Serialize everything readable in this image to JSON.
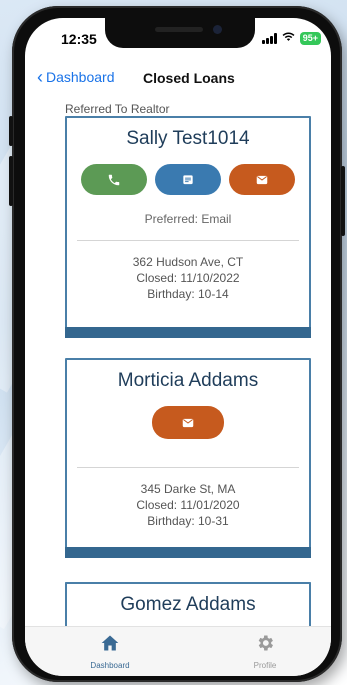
{
  "status_bar": {
    "time": "12:35",
    "battery": "95+"
  },
  "nav": {
    "back_label": "Dashboard",
    "title": "Closed Loans"
  },
  "section_label": "Referred To Realtor",
  "cards": [
    {
      "name": "Sally Test1014",
      "preferred": "Preferred: Email",
      "address": "362 Hudson Ave, CT",
      "closed": "Closed: 11/10/2022",
      "birthday": "Birthday: 10-14"
    },
    {
      "name": "Morticia Addams",
      "address": "345 Darke St, MA",
      "closed": "Closed: 11/01/2020",
      "birthday": "Birthday: 10-31"
    },
    {
      "name": "Gomez Addams"
    }
  ],
  "tabs": [
    {
      "label": "Dashboard",
      "icon": "home-icon"
    },
    {
      "label": "Profile",
      "icon": "gear-icon"
    }
  ],
  "colors": {
    "accent": "#1a73e8",
    "call": "#5c9a55",
    "text": "#3a7ab0",
    "email": "#c65a1e",
    "card_border": "#4a7fa8",
    "card_footer": "#34678f"
  }
}
